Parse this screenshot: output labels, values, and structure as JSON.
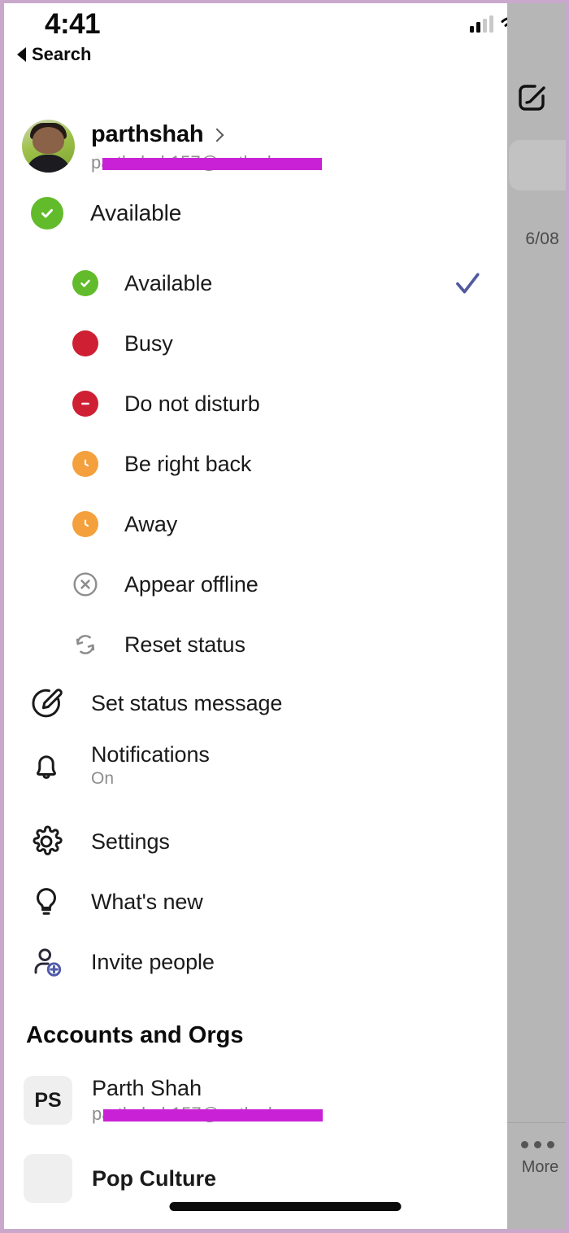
{
  "status_bar": {
    "time": "4:41",
    "signal_icon": "cellular-signal-icon",
    "wifi_icon": "wifi-icon",
    "battery_icon": "battery-icon"
  },
  "back_nav": {
    "label": "Search",
    "icon": "back-triangle-icon"
  },
  "profile": {
    "display_name": "parthshah",
    "email": "parthshah157@outlook.com",
    "email_redacted": true,
    "chevron_icon": "chevron-right-icon",
    "avatar_icon": "user-avatar-photo"
  },
  "current_status": {
    "label": "Available",
    "icon": "available-check-icon",
    "color": "#62bb2a"
  },
  "status_options": [
    {
      "label": "Available",
      "icon": "available-check-icon",
      "color": "#62bb2a",
      "selected": true
    },
    {
      "label": "Busy",
      "icon": "busy-dot-icon",
      "color": "#ce1f33",
      "selected": false
    },
    {
      "label": "Do not disturb",
      "icon": "do-not-disturb-icon",
      "color": "#ce1f33",
      "selected": false
    },
    {
      "label": "Be right back",
      "icon": "clock-icon",
      "color": "#f4a03c",
      "selected": false
    },
    {
      "label": "Away",
      "icon": "clock-icon",
      "color": "#f4a03c",
      "selected": false
    },
    {
      "label": "Appear offline",
      "icon": "offline-x-circle-icon",
      "color": "#8d8d8d",
      "selected": false
    },
    {
      "label": "Reset status",
      "icon": "reset-refresh-icon",
      "color": "#8d8d8d",
      "selected": false
    }
  ],
  "selected_check_icon": "checkmark-icon",
  "selected_check_color": "#525a9e",
  "menu_items": [
    {
      "label": "Set status message",
      "sub": "",
      "icon": "pencil-circle-icon"
    },
    {
      "label": "Notifications",
      "sub": "On",
      "icon": "bell-icon"
    },
    {
      "label": "Settings",
      "sub": "",
      "icon": "gear-icon"
    },
    {
      "label": "What's new",
      "sub": "",
      "icon": "lightbulb-icon"
    },
    {
      "label": "Invite people",
      "sub": "",
      "icon": "add-person-icon"
    }
  ],
  "accounts_section": {
    "title": "Accounts and Orgs",
    "items": [
      {
        "initials": "PS",
        "name": "Parth Shah",
        "email": "parthshah157@outlook.com",
        "email_redacted": true
      },
      {
        "initials": "",
        "name": "Pop Culture",
        "email": "",
        "email_redacted": false
      }
    ]
  },
  "background_app": {
    "compose_icon": "compose-icon",
    "search_pill": "search-bar",
    "date": "6/08",
    "more_tab_label": "More",
    "more_tab_icon": "ellipsis-icon"
  }
}
